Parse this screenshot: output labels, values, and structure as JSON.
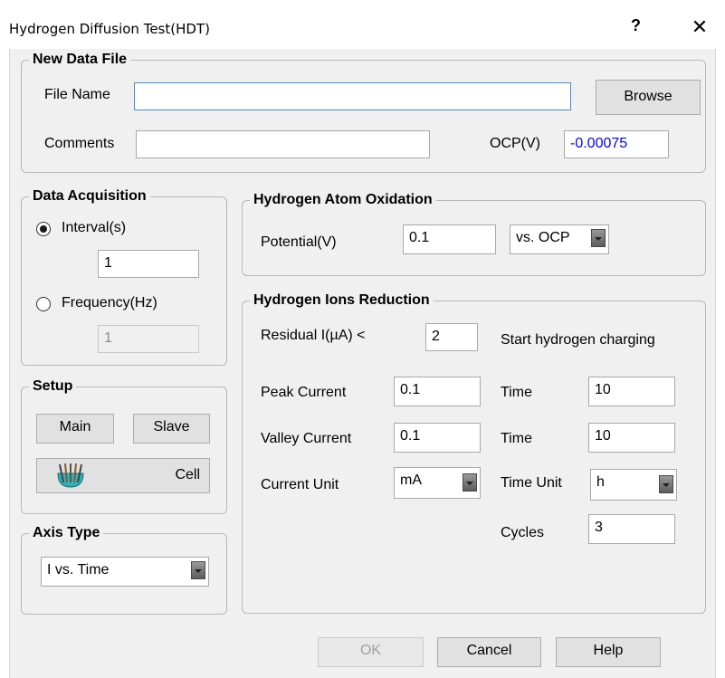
{
  "window": {
    "title": "Hydrogen Diffusion Test(HDT)",
    "help_glyph": "?",
    "close_glyph": "✕"
  },
  "new_data_file": {
    "title": "New Data File",
    "file_name_label": "File Name",
    "file_name_value": "",
    "browse_label": "Browse",
    "comments_label": "Comments",
    "comments_value": "",
    "ocp_label": "OCP(V)",
    "ocp_value": "-0.00075"
  },
  "data_acquisition": {
    "title": "Data Acquisition",
    "interval_label": "Interval(s)",
    "interval_value": "1",
    "frequency_label": "Frequency(Hz)",
    "frequency_value": "1"
  },
  "setup": {
    "title": "Setup",
    "main_label": "Main",
    "slave_label": "Slave",
    "cell_label": "Cell"
  },
  "axis_type": {
    "title": "Axis Type",
    "selected": "I vs. Time"
  },
  "oxidation": {
    "title": "Hydrogen Atom Oxidation",
    "potential_label": "Potential(V)",
    "potential_value": "0.1",
    "reference_selected": "vs. OCP"
  },
  "reduction": {
    "title": "Hydrogen Ions Reduction",
    "residual_label": "Residual I(µA) <",
    "residual_value": "2",
    "start_label": "Start hydrogen charging",
    "peak_current_label": "Peak Current",
    "peak_current_value": "0.1",
    "time1_label": "Time",
    "time1_value": "10",
    "valley_current_label": "Valley Current",
    "valley_current_value": "0.1",
    "time2_label": "Time",
    "time2_value": "10",
    "current_unit_label": "Current Unit",
    "current_unit_selected": "mA",
    "time_unit_label": "Time Unit",
    "time_unit_selected": "h",
    "cycles_label": "Cycles",
    "cycles_value": "3"
  },
  "footer": {
    "ok_label": "OK",
    "cancel_label": "Cancel",
    "help_label": "Help"
  }
}
